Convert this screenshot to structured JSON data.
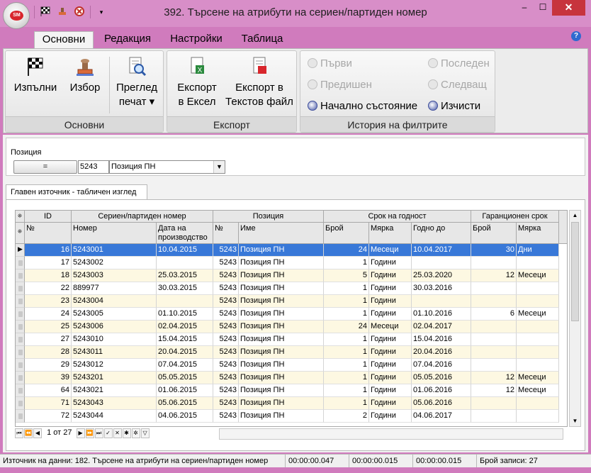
{
  "window": {
    "title": "392. Търсене на атрибути на сериен/партиден номер",
    "close_label": "✕",
    "minimize_label": "–",
    "maximize_label": "☐"
  },
  "app_logo": "SM",
  "tabs": [
    {
      "label": "Основни"
    },
    {
      "label": "Редакция"
    },
    {
      "label": "Настройки"
    },
    {
      "label": "Таблица"
    }
  ],
  "help_label": "?",
  "ribbon": {
    "groups": [
      {
        "caption": "Основни"
      },
      {
        "caption": "Експорт"
      },
      {
        "caption": "История на филтрите"
      }
    ],
    "buttons": {
      "execute": [
        "Изпълни"
      ],
      "select": [
        "Избор"
      ],
      "preview": [
        "Преглед",
        "печат ▾"
      ],
      "excel": [
        "Експорт",
        "в Ексел"
      ],
      "text": [
        "Експорт в",
        "Текстов файл"
      ]
    },
    "history": {
      "first": "Първи",
      "last": "Последен",
      "previous": "Предишен",
      "next": "Следващ",
      "initial": "Начално състояние",
      "clear": "Изчисти"
    }
  },
  "filter": {
    "label": "Позиция",
    "operator": "=",
    "value": "5243",
    "selected": "Позиция ПН"
  },
  "grid_tab": "Главен източник - табличен изглед",
  "grid": {
    "bands": [
      "ID",
      "Сериен/партиден номер",
      "Позиция",
      "Срок на годност",
      "Гаранционен срок"
    ],
    "columns": [
      "№",
      "Номер",
      "Дата на производство",
      "№",
      "Име",
      "Брой",
      "Мярка",
      "Годно до",
      "Брой",
      "Мярка"
    ],
    "rows": [
      [
        "16",
        "5243001",
        "10.04.2015",
        "5243",
        "Позиция ПН",
        "24",
        "Месеци",
        "10.04.2017",
        "30",
        "Дни"
      ],
      [
        "17",
        "5243002",
        "",
        "5243",
        "Позиция ПН",
        "1",
        "Години",
        "",
        "",
        ""
      ],
      [
        "18",
        "5243003",
        "25.03.2015",
        "5243",
        "Позиция ПН",
        "5",
        "Години",
        "25.03.2020",
        "12",
        "Месеци"
      ],
      [
        "22",
        "889977",
        "30.03.2015",
        "5243",
        "Позиция ПН",
        "1",
        "Години",
        "30.03.2016",
        "",
        ""
      ],
      [
        "23",
        "5243004",
        "",
        "5243",
        "Позиция ПН",
        "1",
        "Години",
        "",
        "",
        ""
      ],
      [
        "24",
        "5243005",
        "01.10.2015",
        "5243",
        "Позиция ПН",
        "1",
        "Години",
        "01.10.2016",
        "6",
        "Месеци"
      ],
      [
        "25",
        "5243006",
        "02.04.2015",
        "5243",
        "Позиция ПН",
        "24",
        "Месеци",
        "02.04.2017",
        "",
        ""
      ],
      [
        "27",
        "5243010",
        "15.04.2015",
        "5243",
        "Позиция ПН",
        "1",
        "Години",
        "15.04.2016",
        "",
        ""
      ],
      [
        "28",
        "5243011",
        "20.04.2015",
        "5243",
        "Позиция ПН",
        "1",
        "Години",
        "20.04.2016",
        "",
        ""
      ],
      [
        "29",
        "5243012",
        "07.04.2015",
        "5243",
        "Позиция ПН",
        "1",
        "Години",
        "07.04.2016",
        "",
        ""
      ],
      [
        "39",
        "5243201",
        "05.05.2015",
        "5243",
        "Позиция ПН",
        "1",
        "Години",
        "05.05.2016",
        "12",
        "Месеци"
      ],
      [
        "64",
        "5243021",
        "01.06.2015",
        "5243",
        "Позиция ПН",
        "1",
        "Години",
        "01.06.2016",
        "12",
        "Месеци"
      ],
      [
        "71",
        "5243043",
        "05.06.2015",
        "5243",
        "Позиция ПН",
        "1",
        "Години",
        "05.06.2016",
        "",
        ""
      ],
      [
        "72",
        "5243044",
        "04.06.2015",
        "5243",
        "Позиция ПН",
        "2",
        "Години",
        "04.06.2017",
        "",
        ""
      ]
    ]
  },
  "navigator": {
    "position": "1 от 27"
  },
  "status": {
    "source": "Източник на данни: 182. Търсене на атрибути на сериен/партиден номер",
    "t1": "00:00:00.047",
    "t2": "00:00:00.015",
    "t3": "00:00:00.015",
    "records": "Брой записи: 27"
  }
}
